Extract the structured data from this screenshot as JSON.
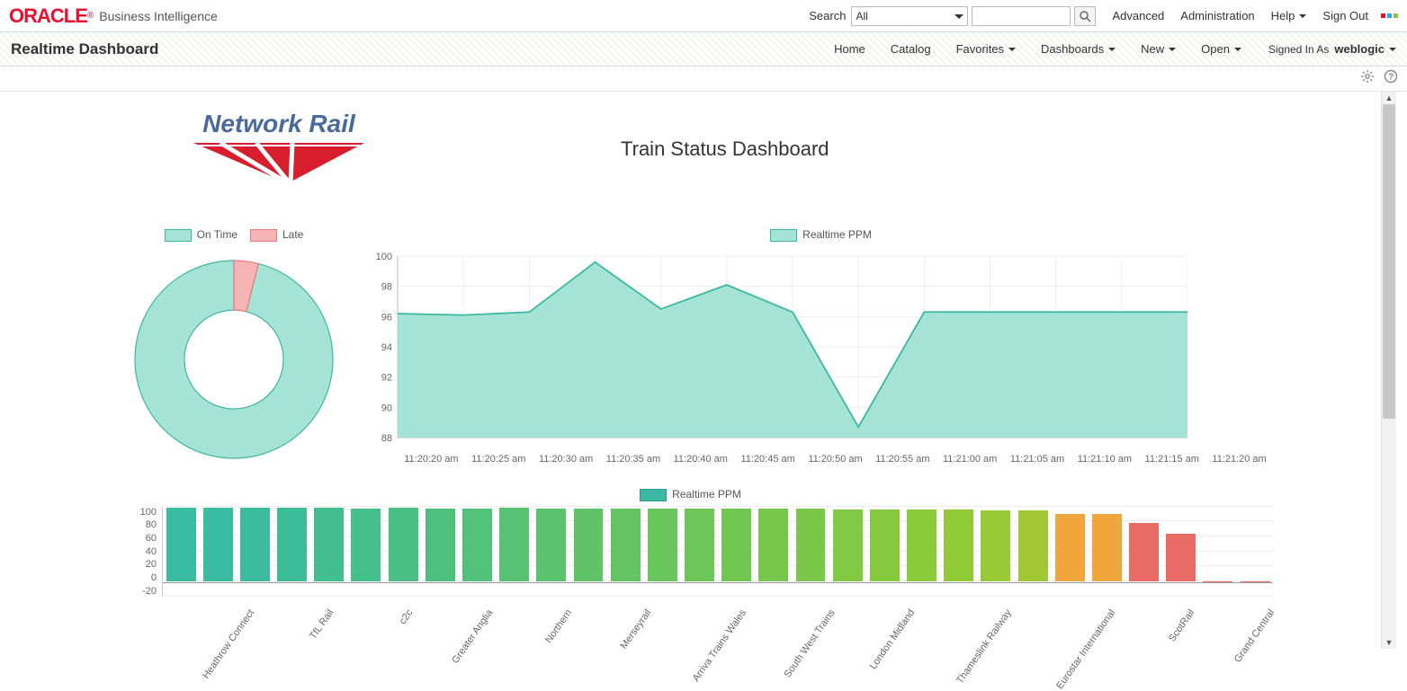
{
  "brand": {
    "oracle": "ORACLE",
    "reg": "®",
    "product": "Business Intelligence"
  },
  "top": {
    "search_label": "Search",
    "scope": "All",
    "input": "",
    "advanced": "Advanced",
    "administration": "Administration",
    "help": "Help",
    "signout": "Sign Out"
  },
  "page_title": "Realtime Dashboard",
  "nav": {
    "home": "Home",
    "catalog": "Catalog",
    "favorites": "Favorites",
    "dashboards": "Dashboards",
    "new": "New",
    "open": "Open",
    "signed_in": "Signed In As",
    "user": "weblogic"
  },
  "logo_text": "Network Rail",
  "dash_title": "Train Status Dashboard",
  "legends": {
    "donut": {
      "on_time": "On Time",
      "late": "Late"
    },
    "ppm": "Realtime PPM"
  },
  "colors": {
    "on_time_fill": "#a6e3d7",
    "on_time_stroke": "#3bb8a2",
    "late_fill": "#f7b4b4",
    "late_stroke": "#ea7b7b",
    "bar_legend": "#3db8a4"
  },
  "chart_data": [
    {
      "type": "pie",
      "title": "",
      "series": [
        {
          "name": "On Time",
          "value": 96
        },
        {
          "name": "Late",
          "value": 4
        }
      ]
    },
    {
      "type": "area",
      "title": "",
      "ylabel": "",
      "ylim": [
        88,
        100
      ],
      "x": [
        "11:20:20 am",
        "11:20:25 am",
        "11:20:30 am",
        "11:20:35 am",
        "11:20:40 am",
        "11:20:45 am",
        "11:20:50 am",
        "11:20:55 am",
        "11:21:00 am",
        "11:21:05 am",
        "11:21:10 am",
        "11:21:15 am",
        "11:21:20 am"
      ],
      "series": [
        {
          "name": "Realtime PPM",
          "values": [
            96.2,
            96.1,
            96.3,
            99.6,
            96.5,
            98.1,
            96.3,
            88.7,
            96.3,
            96.3,
            96.3,
            96.3,
            96.3
          ]
        }
      ]
    },
    {
      "type": "bar",
      "title": "",
      "ylabel": "",
      "ylim": [
        -20,
        100
      ],
      "categories": [
        "Heathrow Connect",
        "TfL Rail",
        "c2c",
        "Greater Anglia",
        "Northern",
        "Merseyrail",
        "Arriva Trains Wales",
        "South West Trains",
        "London Midland",
        "Thameslink Railway",
        "Eurostar International",
        "ScotRail",
        "Grand Central"
      ],
      "series": [
        {
          "name": "Realtime PPM",
          "values": [
            99,
            99,
            99,
            99,
            98,
            97,
            98,
            97,
            97,
            98,
            97,
            97,
            97,
            97,
            97,
            97,
            97,
            97,
            96,
            96,
            96,
            96,
            95,
            95,
            90,
            90,
            78,
            64,
            0,
            0
          ]
        }
      ],
      "bar_gradient": [
        "#39bca1",
        "#39bca1",
        "#3bbc9d",
        "#3dbd97",
        "#42be90",
        "#45bf8b",
        "#4abf85",
        "#4ec07e",
        "#52c179",
        "#57c274",
        "#5bc26e",
        "#60c368",
        "#64c463",
        "#69c55d",
        "#6ec658",
        "#72c753",
        "#77c74d",
        "#7bc848",
        "#80c942",
        "#85ca3d",
        "#8acb39",
        "#90cb37",
        "#97ca36",
        "#9fc834",
        "#f0a63c",
        "#f0a63c",
        "#e86b65",
        "#e86b65",
        "#e86b65",
        "#e86b65"
      ]
    }
  ]
}
